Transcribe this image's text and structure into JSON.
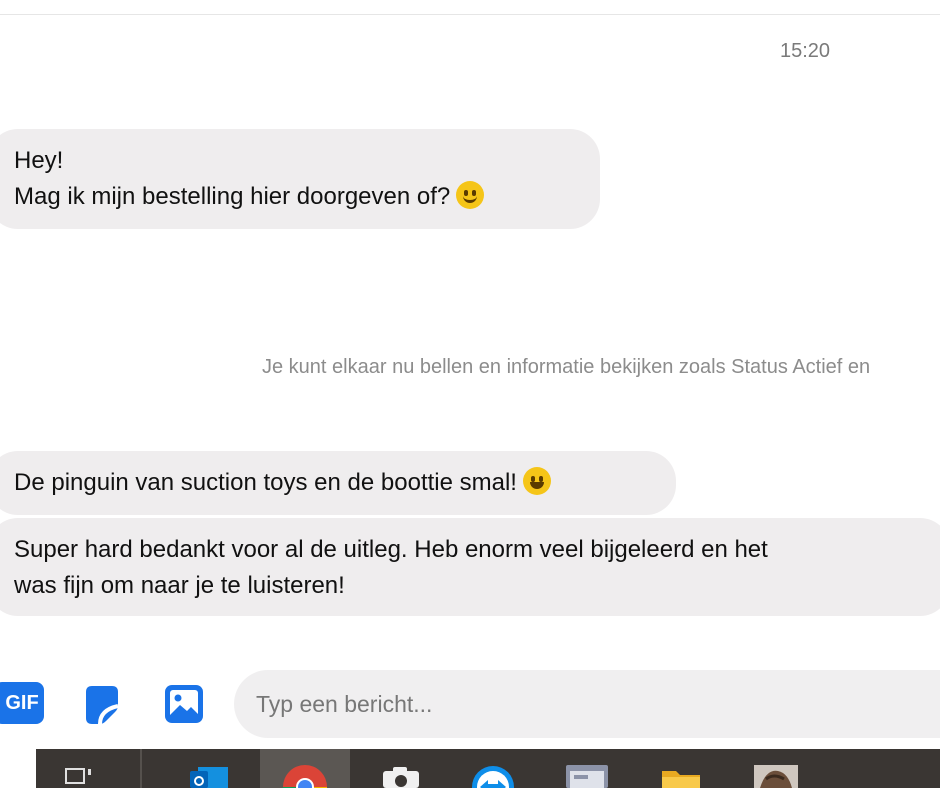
{
  "chat": {
    "timestamp": "15:20",
    "messages": [
      {
        "lines": [
          "Hey!",
          "Mag ik mijn bestelling hier doorgeven of?"
        ],
        "emoji": "slightly-smiling-face"
      },
      {
        "lines": [
          "De pinguin van suction toys en de boottie smal!"
        ],
        "emoji": "grinning-face"
      },
      {
        "lines": [
          "Super hard bedankt voor al de uitleg. Heb enorm veel bijgeleerd en het",
          "was fijn om naar je te luisteren!"
        ]
      }
    ],
    "system_message": "Je kunt elkaar nu bellen en informatie bekijken zoals Status Actief en"
  },
  "composer": {
    "gif_label": "GIF",
    "input_placeholder": "Typ een bericht...",
    "accent_color": "#1a73e8"
  },
  "taskbar": {
    "items": [
      "task-view-icon",
      "outlook-icon",
      "chrome-icon",
      "camera-icon",
      "teamviewer-icon",
      "app-window-icon",
      "file-explorer-icon",
      "photo-app-icon"
    ],
    "active_item": "chrome-icon"
  }
}
